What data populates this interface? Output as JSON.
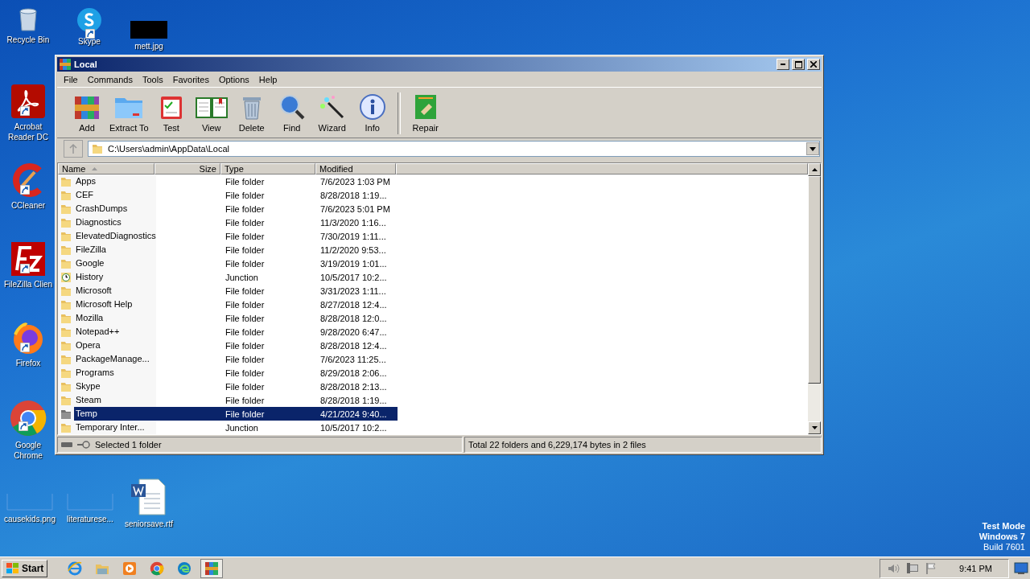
{
  "desktop": {
    "icons": [
      {
        "label": "Recycle Bin",
        "kind": "recycle",
        "shortcut": false
      },
      {
        "label": "Skype",
        "kind": "skype",
        "shortcut": true
      },
      {
        "label": "mett.jpg",
        "kind": "black-image",
        "shortcut": false
      },
      {
        "label": "Acrobat Reader DC",
        "kind": "acrobat",
        "shortcut": true
      },
      {
        "label": "CCleaner",
        "kind": "ccleaner",
        "shortcut": true
      },
      {
        "label": "FileZilla Clien",
        "kind": "filezilla",
        "shortcut": true
      },
      {
        "label": "Firefox",
        "kind": "firefox",
        "shortcut": true
      },
      {
        "label": "Google Chrome",
        "kind": "chrome",
        "shortcut": true
      },
      {
        "label": "causekids.png",
        "kind": "blank",
        "shortcut": false
      },
      {
        "label": "literaturese...",
        "kind": "blank",
        "shortcut": false
      },
      {
        "label": "seniorsave.rtf",
        "kind": "word",
        "shortcut": false
      }
    ],
    "system_text": [
      "Test Mode",
      "Windows 7",
      "Build 7601"
    ]
  },
  "window": {
    "title": "Local",
    "menu": [
      "File",
      "Commands",
      "Tools",
      "Favorites",
      "Options",
      "Help"
    ],
    "toolbar": [
      {
        "label": "Add",
        "kind": "add",
        "separator_before": false
      },
      {
        "label": "Extract To",
        "kind": "extract",
        "separator_before": false
      },
      {
        "label": "Test",
        "kind": "test",
        "separator_before": false
      },
      {
        "label": "View",
        "kind": "view",
        "separator_before": false
      },
      {
        "label": "Delete",
        "kind": "delete",
        "separator_before": false
      },
      {
        "label": "Find",
        "kind": "find",
        "separator_before": false
      },
      {
        "label": "Wizard",
        "kind": "wizard",
        "separator_before": false
      },
      {
        "label": "Info",
        "kind": "info",
        "separator_before": false
      },
      {
        "label": "Repair",
        "kind": "repair",
        "separator_before": true
      }
    ],
    "address": {
      "value": "C:\\Users\\admin\\AppData\\Local"
    },
    "columns": [
      "Name",
      "Size",
      "Type",
      "Modified"
    ],
    "rows": [
      {
        "name": "Apps",
        "type": "File folder",
        "modified": "7/6/2023 1:03 PM",
        "kind": "folder",
        "selected": false
      },
      {
        "name": "CEF",
        "type": "File folder",
        "modified": "8/28/2018 1:19...",
        "kind": "folder",
        "selected": false
      },
      {
        "name": "CrashDumps",
        "type": "File folder",
        "modified": "7/6/2023 5:01 PM",
        "kind": "folder",
        "selected": false
      },
      {
        "name": "Diagnostics",
        "type": "File folder",
        "modified": "11/3/2020 1:16...",
        "kind": "folder",
        "selected": false
      },
      {
        "name": "ElevatedDiagnostics",
        "type": "File folder",
        "modified": "7/30/2019 1:11...",
        "kind": "folder",
        "selected": false
      },
      {
        "name": "FileZilla",
        "type": "File folder",
        "modified": "11/2/2020 9:53...",
        "kind": "folder",
        "selected": false
      },
      {
        "name": "Google",
        "type": "File folder",
        "modified": "3/19/2019 1:01...",
        "kind": "folder",
        "selected": false
      },
      {
        "name": "History",
        "type": "Junction",
        "modified": "10/5/2017 10:2...",
        "kind": "junction",
        "selected": false
      },
      {
        "name": "Microsoft",
        "type": "File folder",
        "modified": "3/31/2023 1:11...",
        "kind": "folder",
        "selected": false
      },
      {
        "name": "Microsoft Help",
        "type": "File folder",
        "modified": "8/27/2018 12:4...",
        "kind": "folder",
        "selected": false
      },
      {
        "name": "Mozilla",
        "type": "File folder",
        "modified": "8/28/2018 12:0...",
        "kind": "folder",
        "selected": false
      },
      {
        "name": "Notepad++",
        "type": "File folder",
        "modified": "9/28/2020 6:47...",
        "kind": "folder",
        "selected": false
      },
      {
        "name": "Opera",
        "type": "File folder",
        "modified": "8/28/2018 12:4...",
        "kind": "folder",
        "selected": false
      },
      {
        "name": "PackageManage...",
        "type": "File folder",
        "modified": "7/6/2023 11:25...",
        "kind": "folder",
        "selected": false
      },
      {
        "name": "Programs",
        "type": "File folder",
        "modified": "8/29/2018 2:06...",
        "kind": "folder",
        "selected": false
      },
      {
        "name": "Skype",
        "type": "File folder",
        "modified": "8/28/2018 2:13...",
        "kind": "folder",
        "selected": false
      },
      {
        "name": "Steam",
        "type": "File folder",
        "modified": "8/28/2018 1:19...",
        "kind": "folder",
        "selected": false
      },
      {
        "name": "Temp",
        "type": "File folder",
        "modified": "4/21/2024 9:40...",
        "kind": "gray-folder",
        "selected": true
      },
      {
        "name": "Temporary Inter...",
        "type": "Junction",
        "modified": "10/5/2017 10:2...",
        "kind": "folder",
        "selected": false
      }
    ],
    "status": {
      "left": "Selected 1 folder",
      "right": "Total 22 folders and 6,229,174 bytes in 2 files"
    }
  },
  "taskbar": {
    "start": "Start",
    "apps": [
      {
        "kind": "ie",
        "active": false
      },
      {
        "kind": "explorer",
        "active": false
      },
      {
        "kind": "media",
        "active": false
      },
      {
        "kind": "chrome",
        "active": false
      },
      {
        "kind": "edge",
        "active": false
      },
      {
        "kind": "winrar",
        "active": true
      }
    ],
    "tray": [
      {
        "kind": "volume"
      },
      {
        "kind": "network"
      },
      {
        "kind": "flag"
      }
    ],
    "clock": "9:41 PM"
  }
}
